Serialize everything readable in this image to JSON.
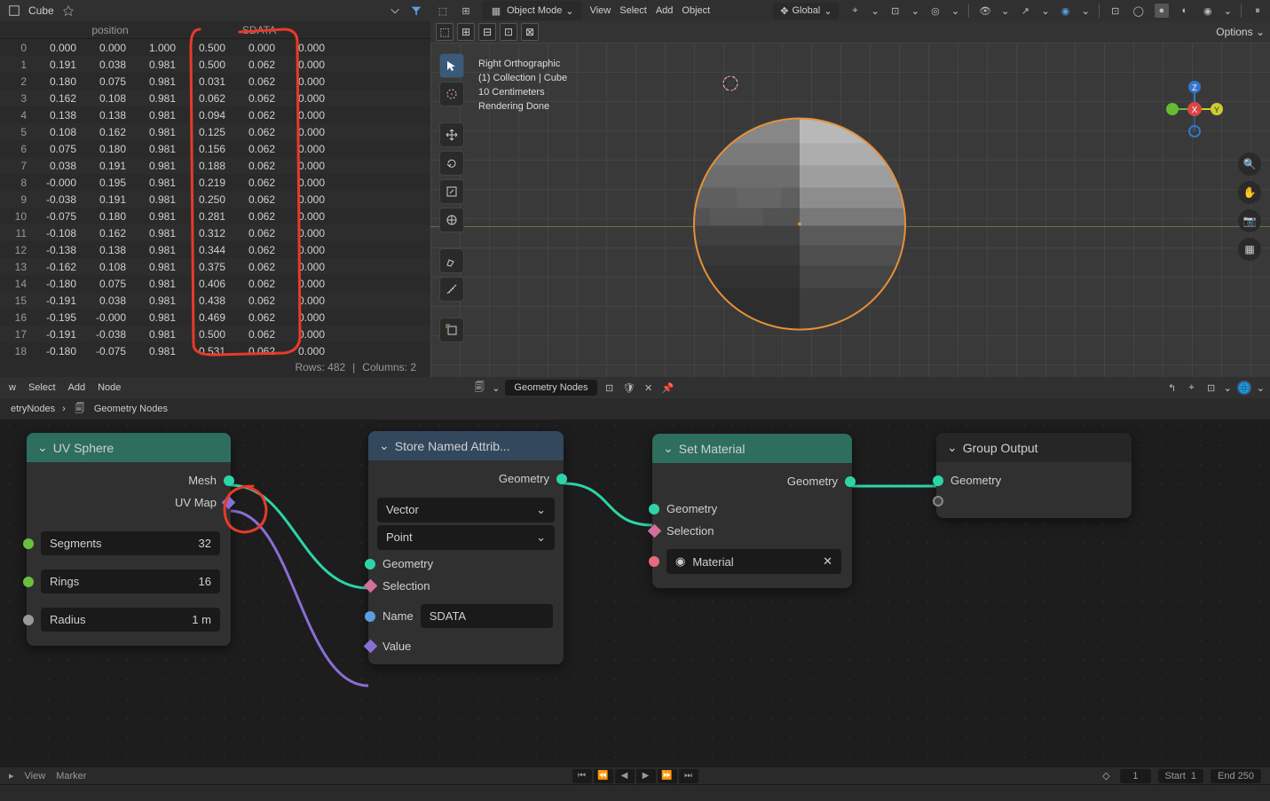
{
  "spreadsheet": {
    "object_name": "Cube",
    "col_group_1": "position",
    "col_group_2": "SDATA",
    "rows": [
      {
        "i": "0",
        "p": [
          "0.000",
          "0.000",
          "1.000"
        ],
        "s": [
          "0.500",
          "0.000"
        ],
        "e": "0.000"
      },
      {
        "i": "1",
        "p": [
          "0.191",
          "0.038",
          "0.981"
        ],
        "s": [
          "0.500",
          "0.062"
        ],
        "e": "0.000"
      },
      {
        "i": "2",
        "p": [
          "0.180",
          "0.075",
          "0.981"
        ],
        "s": [
          "0.031",
          "0.062"
        ],
        "e": "0.000"
      },
      {
        "i": "3",
        "p": [
          "0.162",
          "0.108",
          "0.981"
        ],
        "s": [
          "0.062",
          "0.062"
        ],
        "e": "0.000"
      },
      {
        "i": "4",
        "p": [
          "0.138",
          "0.138",
          "0.981"
        ],
        "s": [
          "0.094",
          "0.062"
        ],
        "e": "0.000"
      },
      {
        "i": "5",
        "p": [
          "0.108",
          "0.162",
          "0.981"
        ],
        "s": [
          "0.125",
          "0.062"
        ],
        "e": "0.000"
      },
      {
        "i": "6",
        "p": [
          "0.075",
          "0.180",
          "0.981"
        ],
        "s": [
          "0.156",
          "0.062"
        ],
        "e": "0.000"
      },
      {
        "i": "7",
        "p": [
          "0.038",
          "0.191",
          "0.981"
        ],
        "s": [
          "0.188",
          "0.062"
        ],
        "e": "0.000"
      },
      {
        "i": "8",
        "p": [
          "-0.000",
          "0.195",
          "0.981"
        ],
        "s": [
          "0.219",
          "0.062"
        ],
        "e": "0.000"
      },
      {
        "i": "9",
        "p": [
          "-0.038",
          "0.191",
          "0.981"
        ],
        "s": [
          "0.250",
          "0.062"
        ],
        "e": "0.000"
      },
      {
        "i": "10",
        "p": [
          "-0.075",
          "0.180",
          "0.981"
        ],
        "s": [
          "0.281",
          "0.062"
        ],
        "e": "0.000"
      },
      {
        "i": "11",
        "p": [
          "-0.108",
          "0.162",
          "0.981"
        ],
        "s": [
          "0.312",
          "0.062"
        ],
        "e": "0.000"
      },
      {
        "i": "12",
        "p": [
          "-0.138",
          "0.138",
          "0.981"
        ],
        "s": [
          "0.344",
          "0.062"
        ],
        "e": "0.000"
      },
      {
        "i": "13",
        "p": [
          "-0.162",
          "0.108",
          "0.981"
        ],
        "s": [
          "0.375",
          "0.062"
        ],
        "e": "0.000"
      },
      {
        "i": "14",
        "p": [
          "-0.180",
          "0.075",
          "0.981"
        ],
        "s": [
          "0.406",
          "0.062"
        ],
        "e": "0.000"
      },
      {
        "i": "15",
        "p": [
          "-0.191",
          "0.038",
          "0.981"
        ],
        "s": [
          "0.438",
          "0.062"
        ],
        "e": "0.000"
      },
      {
        "i": "16",
        "p": [
          "-0.195",
          "-0.000",
          "0.981"
        ],
        "s": [
          "0.469",
          "0.062"
        ],
        "e": "0.000"
      },
      {
        "i": "17",
        "p": [
          "-0.191",
          "-0.038",
          "0.981"
        ],
        "s": [
          "0.500",
          "0.062"
        ],
        "e": "0.000"
      },
      {
        "i": "18",
        "p": [
          "-0.180",
          "-0.075",
          "0.981"
        ],
        "s": [
          "0.531",
          "0.062"
        ],
        "e": "0.000"
      }
    ],
    "footer_rows": "Rows: 482",
    "footer_cols": "Columns: 2"
  },
  "viewport": {
    "mode": "Object Mode",
    "menu_view": "View",
    "menu_select": "Select",
    "menu_add": "Add",
    "menu_object": "Object",
    "orient": "Global",
    "info_line1": "Right Orthographic",
    "info_line2": "(1) Collection | Cube",
    "info_line3": "10 Centimeters",
    "info_line4": "Rendering Done",
    "options": "Options"
  },
  "node_editor": {
    "menu_w": "w",
    "menu_select": "Select",
    "menu_add": "Add",
    "menu_node": "Node",
    "tree_name": "Geometry Nodes",
    "breadcrumb1": "etryNodes",
    "breadcrumb2": "Geometry Nodes"
  },
  "nodes": {
    "uvsphere": {
      "title": "UV Sphere",
      "mesh": "Mesh",
      "uvmap": "UV Map",
      "segments": "Segments",
      "segments_v": "32",
      "rings": "Rings",
      "rings_v": "16",
      "radius": "Radius",
      "radius_v": "1 m"
    },
    "store": {
      "title": "Store Named Attrib...",
      "out_geo": "Geometry",
      "type": "Vector",
      "domain": "Point",
      "in_geo": "Geometry",
      "sel": "Selection",
      "name": "Name",
      "name_v": "SDATA",
      "val": "Value"
    },
    "setmat": {
      "title": "Set Material",
      "out_geo": "Geometry",
      "in_geo": "Geometry",
      "sel": "Selection",
      "mat": "Material"
    },
    "output": {
      "title": "Group Output",
      "geo": "Geometry"
    }
  },
  "timeline": {
    "menu_view": "View",
    "menu_marker": "Marker",
    "frame": "1",
    "start": "Start",
    "start_v": "1",
    "end": "End",
    "end_v": "250"
  }
}
